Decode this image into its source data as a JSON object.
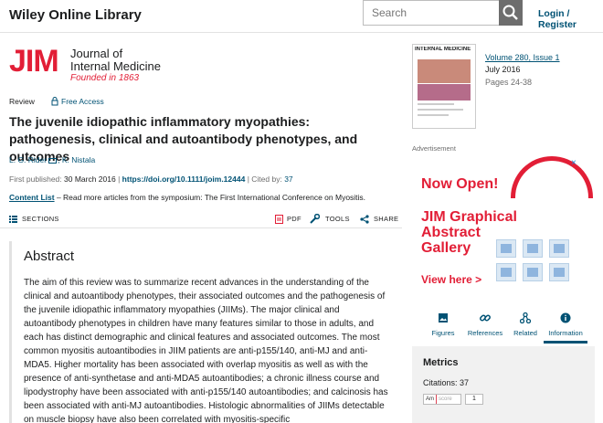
{
  "header": {
    "brand": "Wiley Online Library",
    "search_placeholder": "Search",
    "login": "Login / Register"
  },
  "journal": {
    "mark": "JIM",
    "name_line1": "Journal of",
    "name_line2": "Internal Medicine",
    "founded": "Founded in 1863"
  },
  "article": {
    "type": "Review",
    "access": "Free Access",
    "title": "The juvenile idiopathic inflammatory myopathies: pathogenesis, clinical and autoantibody phenotypes, and outcomes",
    "authors": [
      "L. G. Rider",
      "K. Nistala"
    ],
    "first_published_label": "First published:",
    "first_published": "30 March 2016",
    "doi": "https://doi.org/10.1111/joim.12444",
    "cited_label": "Cited by:",
    "cited": "37",
    "content_list_label": "Content List",
    "content_list_text": "– Read more articles from the symposium: The First International Conference on Myositis."
  },
  "actions": {
    "sections": "SECTIONS",
    "pdf": "PDF",
    "tools": "TOOLS",
    "share": "SHARE"
  },
  "abstract": {
    "heading": "Abstract",
    "text": "The aim of this review was to summarize recent advances in the understanding of the clinical and autoantibody phenotypes, their associated outcomes and the pathogenesis of the juvenile idiopathic inflammatory myopathies (JIIMs). The major clinical and autoantibody phenotypes in children have many features similar to those in adults, and each has distinct demographic and clinical features and associated outcomes. The most common myositis autoantibodies in JIIM patients are anti-p155/140, anti-MJ and anti-MDA5. Higher mortality has been associated with overlap myositis as well as with the presence of anti-synthetase and anti-MDA5 autoantibodies; a chronic illness course and lipodystrophy have been associated with anti-p155/140 autoantibodies; and calcinosis has been associated with anti-MJ autoantibodies. Histologic abnormalities of JIIMs detectable on muscle biopsy have also been correlated with myositis-specific"
  },
  "issue": {
    "cover_title": "INTERNAL MEDICINE",
    "volume_label": "Volume 280, Issue 1",
    "date": "July 2016",
    "pages": "Pages 24-38"
  },
  "ad": {
    "label": "Advertisement",
    "close": "×",
    "now_open": "Now Open!",
    "line1": "JIM Graphical",
    "line2": "Abstract",
    "line3": "Gallery",
    "cta": "View here >"
  },
  "tabs": [
    {
      "label": "Figures",
      "icon": "image-icon"
    },
    {
      "label": "References",
      "icon": "link-icon"
    },
    {
      "label": "Related",
      "icon": "network-icon"
    },
    {
      "label": "Information",
      "icon": "info-icon"
    }
  ],
  "metrics": {
    "heading": "Metrics",
    "citations": "Citations: 37",
    "altmetric_badge": "Am",
    "altmetric_word": "score",
    "altmetric_score": "1"
  },
  "colors": {
    "brand_red": "#e21e36",
    "link_blue": "#005274"
  }
}
